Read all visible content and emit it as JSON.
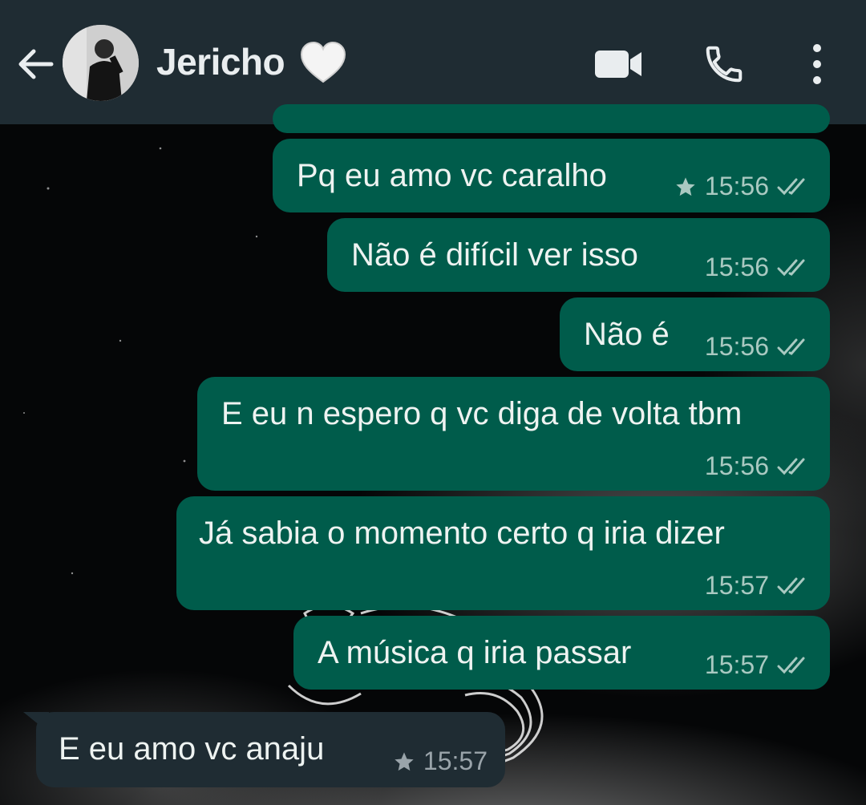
{
  "header": {
    "contact_name": "Jericho",
    "heart_emoji": "🤍",
    "icons": {
      "back": "arrow-left-icon",
      "video": "video-camera-icon",
      "call": "phone-icon",
      "menu": "more-vert-icon"
    }
  },
  "messages": [
    {
      "direction": "out",
      "text": "Pq eu amo vc caralho",
      "time": "15:56",
      "starred": true,
      "status": "read"
    },
    {
      "direction": "out",
      "text": "Não é difícil ver isso",
      "time": "15:56",
      "starred": false,
      "status": "read"
    },
    {
      "direction": "out",
      "text": "Não é",
      "time": "15:56",
      "starred": false,
      "status": "read"
    },
    {
      "direction": "out",
      "text": "E eu n espero q vc diga de volta tbm",
      "time": "15:56",
      "starred": false,
      "status": "read"
    },
    {
      "direction": "out",
      "text": "Já sabia o momento certo q iria dizer",
      "time": "15:57",
      "starred": false,
      "status": "read"
    },
    {
      "direction": "out",
      "text": "A música q iria passar",
      "time": "15:57",
      "starred": false,
      "status": "read"
    },
    {
      "direction": "in",
      "text": "E eu amo vc anaju",
      "time": "15:57",
      "starred": true
    }
  ],
  "colors": {
    "header_bg": "#1f2c33",
    "outgoing_bubble": "#005c4b",
    "incoming_bubble": "#1f2c33",
    "text": "#eef3f1"
  }
}
